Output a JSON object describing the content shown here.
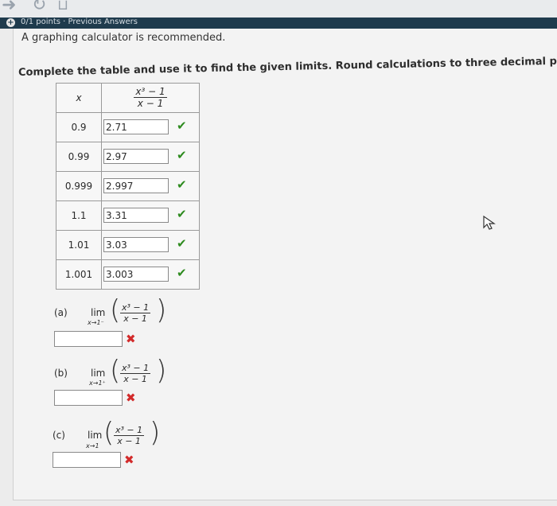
{
  "topbar": {
    "points_text": "0/1 points · Previous Answers"
  },
  "question": {
    "intro": "A graphing calculator is recommended.",
    "instruction": "Complete the table and use it to find the given limits. Round calculations to three decimal places."
  },
  "table": {
    "x_header": "x",
    "f_numerator": "x³ − 1",
    "f_denominator": "x − 1",
    "rows": [
      {
        "x": "0.9",
        "answer": "2.71"
      },
      {
        "x": "0.99",
        "answer": "2.97"
      },
      {
        "x": "0.999",
        "answer": "2.997"
      },
      {
        "x": "1.1",
        "answer": "3.31"
      },
      {
        "x": "1.01",
        "answer": "3.03"
      },
      {
        "x": "1.001",
        "answer": "3.003"
      }
    ]
  },
  "parts": [
    {
      "label": "(a)",
      "lim": "lim",
      "sub": "x→1⁻",
      "numerator": "x³ − 1",
      "denominator": "x − 1",
      "answer": ""
    },
    {
      "label": "(b)",
      "lim": "lim",
      "sub": "x→1⁺",
      "numerator": "x³ − 1",
      "denominator": "x − 1",
      "answer": ""
    },
    {
      "label": "(c)",
      "lim": "lim",
      "sub": "x→1",
      "numerator": "x³ − 1",
      "denominator": "x − 1",
      "answer": ""
    }
  ],
  "icons": {
    "correct": "checkmark-icon",
    "incorrect": "x-mark-icon"
  },
  "colors": {
    "correct": "#2e8b1f",
    "incorrect": "#d22a2a",
    "header_strip": "#1f3b4d"
  }
}
